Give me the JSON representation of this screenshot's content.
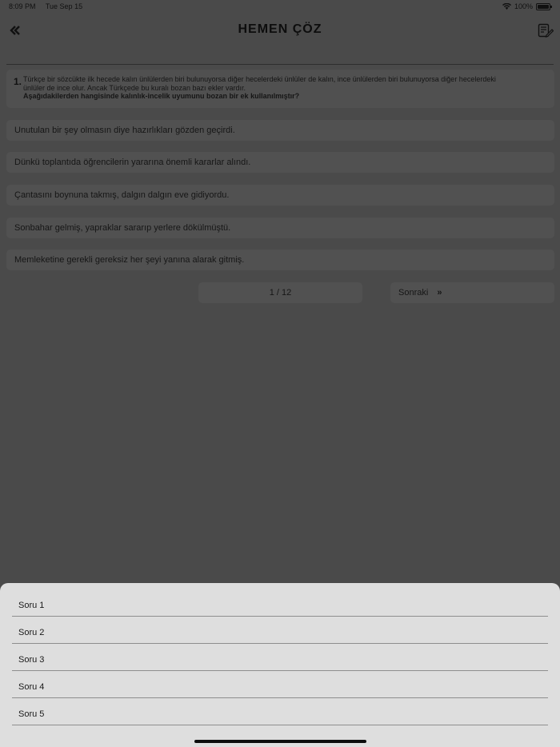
{
  "status_bar": {
    "time": "8:09 PM",
    "date": "Tue Sep 15",
    "battery_percent": "100%",
    "icons": [
      "wifi-icon",
      "battery-icon"
    ]
  },
  "nav": {
    "title": "HEMEN ÇÖZ",
    "back_icon": "double-chevron-left-icon",
    "notes_icon": "notepad-pencil-icon"
  },
  "question": {
    "number": "1.",
    "line1": "Türkçe bir sözcükte ilk hecede kalın ünlülerden biri bulunuyorsa diğer hecelerdeki ünlüler de kalın, ince ünlülerden biri bulunuyorsa diğer hecelerdeki",
    "line2": "ünlüler de ince olur. Ancak Türkçede bu kuralı bozan bazı ekler vardır.",
    "prompt": "Aşağıdakilerden hangisinde kalınlık-incelik uyumunu bozan bir ek kullanılmıştır?"
  },
  "options": [
    "Unutulan bir şey olmasın diye hazırlıkları gözden geçirdi.",
    "Dünkü toplantıda öğrencilerin yararına önemli kararlar alındı.",
    "Çantasını boynuna takmış, dalgın dalgın eve gidiyordu.",
    "Sonbahar gelmiş, yapraklar sararıp yerlere dökülmüştü.",
    "Memleketine gerekli gereksiz her şeyi yanına alarak gitmiş."
  ],
  "pager": {
    "indicator": "1 / 12",
    "next_label": "Sonraki",
    "next_icon": "double-chevron-right-icon"
  },
  "sheet": {
    "items": [
      "Soru 1",
      "Soru 2",
      "Soru 3",
      "Soru 4",
      "Soru 5"
    ]
  },
  "colors": {
    "dim_background": "#4a4a4a",
    "sheet_background": "#dedede"
  }
}
